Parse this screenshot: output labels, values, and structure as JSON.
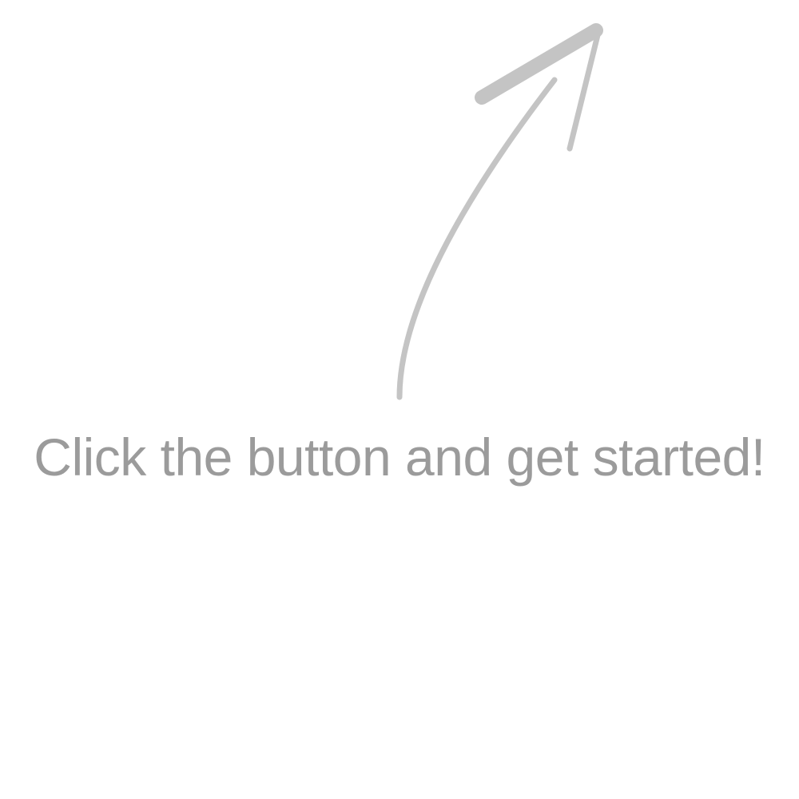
{
  "hint": {
    "text": "Click the button and get started!",
    "arrow_icon": "hand-drawn-arrow-icon",
    "arrow_color": "#c4c4c4",
    "text_color": "#9b9b9b"
  }
}
